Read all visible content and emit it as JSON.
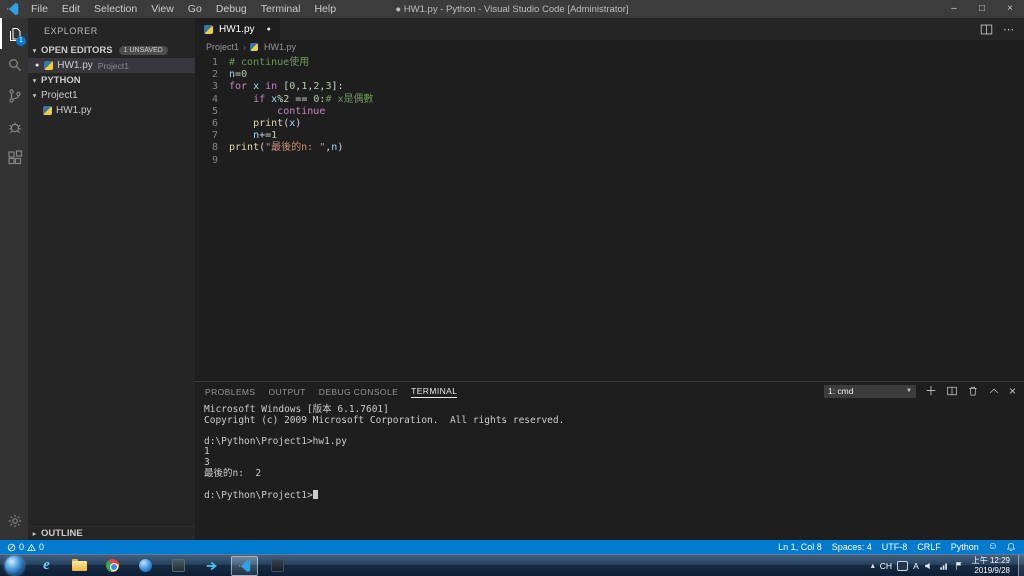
{
  "titlebar": {
    "menus": [
      "File",
      "Edit",
      "Selection",
      "View",
      "Go",
      "Debug",
      "Terminal",
      "Help"
    ],
    "title": "● HW1.py - Python - Visual Studio Code [Administrator]",
    "controls": {
      "minimize": "–",
      "maximize": "□",
      "close": "×"
    }
  },
  "activitybar": {
    "badge": "1",
    "items": [
      {
        "name": "explorer",
        "active": true
      },
      {
        "name": "search"
      },
      {
        "name": "source-control"
      },
      {
        "name": "debug"
      },
      {
        "name": "extensions"
      }
    ],
    "bottom": [
      {
        "name": "settings"
      }
    ]
  },
  "sidebar": {
    "title": "EXPLORER",
    "open_editors": {
      "label": "OPEN EDITORS",
      "badge": "1 UNSAVED",
      "item": {
        "dirty": "●",
        "file": "HW1.py",
        "detail": "Project1"
      }
    },
    "workspace": {
      "label": "PYTHON"
    },
    "tree": {
      "folder": "Project1",
      "file": "HW1.py"
    },
    "outline": {
      "label": "OUTLINE"
    }
  },
  "editor": {
    "tab_label": "HW1.py",
    "tab_dirty": "●",
    "breadcrumb": [
      "Project1",
      "HW1.py"
    ],
    "code_lines": [
      {
        "n": 1,
        "tokens": [
          {
            "c": "comment",
            "t": "# continue使用"
          }
        ]
      },
      {
        "n": 2,
        "tokens": [
          {
            "c": "var",
            "t": "n"
          },
          {
            "c": "op",
            "t": "="
          },
          {
            "c": "num",
            "t": "0"
          }
        ]
      },
      {
        "n": 3,
        "tokens": [
          {
            "c": "kw",
            "t": "for"
          },
          {
            "c": "plain",
            "t": " "
          },
          {
            "c": "var",
            "t": "x"
          },
          {
            "c": "plain",
            "t": " "
          },
          {
            "c": "kw",
            "t": "in"
          },
          {
            "c": "plain",
            "t": " ["
          },
          {
            "c": "num",
            "t": "0"
          },
          {
            "c": "plain",
            "t": ","
          },
          {
            "c": "num",
            "t": "1"
          },
          {
            "c": "plain",
            "t": ","
          },
          {
            "c": "num",
            "t": "2"
          },
          {
            "c": "plain",
            "t": ","
          },
          {
            "c": "num",
            "t": "3"
          },
          {
            "c": "plain",
            "t": "]:"
          }
        ]
      },
      {
        "n": 4,
        "tokens": [
          {
            "c": "plain",
            "t": "    "
          },
          {
            "c": "kw",
            "t": "if"
          },
          {
            "c": "plain",
            "t": " "
          },
          {
            "c": "var",
            "t": "x"
          },
          {
            "c": "op",
            "t": "%"
          },
          {
            "c": "num",
            "t": "2"
          },
          {
            "c": "plain",
            "t": " "
          },
          {
            "c": "op",
            "t": "=="
          },
          {
            "c": "plain",
            "t": " "
          },
          {
            "c": "num",
            "t": "0"
          },
          {
            "c": "plain",
            "t": ":"
          },
          {
            "c": "comment",
            "t": "# x是偶數"
          }
        ]
      },
      {
        "n": 5,
        "tokens": [
          {
            "c": "plain",
            "t": "        "
          },
          {
            "c": "kw",
            "t": "continue"
          }
        ]
      },
      {
        "n": 6,
        "tokens": [
          {
            "c": "plain",
            "t": "    "
          },
          {
            "c": "fn",
            "t": "print"
          },
          {
            "c": "plain",
            "t": "("
          },
          {
            "c": "var",
            "t": "x"
          },
          {
            "c": "plain",
            "t": ")"
          }
        ]
      },
      {
        "n": 7,
        "tokens": [
          {
            "c": "plain",
            "t": "    "
          },
          {
            "c": "var",
            "t": "n"
          },
          {
            "c": "op",
            "t": "+="
          },
          {
            "c": "num",
            "t": "1"
          }
        ]
      },
      {
        "n": 8,
        "tokens": [
          {
            "c": "fn",
            "t": "print"
          },
          {
            "c": "plain",
            "t": "("
          },
          {
            "c": "str",
            "t": "\"最後的n: \""
          },
          {
            "c": "plain",
            "t": ","
          },
          {
            "c": "var",
            "t": "n"
          },
          {
            "c": "plain",
            "t": ")"
          }
        ]
      },
      {
        "n": 9,
        "tokens": []
      }
    ]
  },
  "panel": {
    "tabs": [
      {
        "name": "problems",
        "label": "PROBLEMS"
      },
      {
        "name": "output",
        "label": "OUTPUT"
      },
      {
        "name": "debug-console",
        "label": "DEBUG CONSOLE"
      },
      {
        "name": "terminal",
        "label": "TERMINAL",
        "active": true
      }
    ],
    "dropdown_value": "1: cmd",
    "terminal_lines": [
      "Microsoft Windows [版本 6.1.7601]",
      "Copyright (c) 2009 Microsoft Corporation.  All rights reserved.",
      "",
      "d:\\Python\\Project1>hw1.py",
      "1",
      "3",
      "最後的n:  2",
      "",
      "d:\\Python\\Project1>"
    ],
    "cursor_line": 8
  },
  "statusbar": {
    "problems": {
      "errors": "0",
      "warnings": "0"
    },
    "right": [
      {
        "name": "cursor-position",
        "label": "Ln 1, Col 8"
      },
      {
        "name": "indentation",
        "label": "Spaces: 4"
      },
      {
        "name": "encoding",
        "label": "UTF-8"
      },
      {
        "name": "eol",
        "label": "CRLF"
      },
      {
        "name": "language-mode",
        "label": "Python"
      }
    ]
  },
  "taskbar": {
    "icons": [
      {
        "name": "ie-icon",
        "kind": "ie"
      },
      {
        "name": "file-explorer-icon",
        "kind": "folder"
      },
      {
        "name": "chrome-icon",
        "kind": "chrome"
      },
      {
        "name": "media-app-icon",
        "kind": "bluecircle"
      },
      {
        "name": "app-icon-1",
        "kind": "darkapp"
      },
      {
        "name": "arrow-app-icon",
        "kind": "arrow"
      },
      {
        "name": "vscode-icon",
        "kind": "vscode",
        "active": true
      },
      {
        "name": "app-icon-2",
        "kind": "darkapp2"
      }
    ],
    "tray": {
      "ime_lang": "CH",
      "ime_mode": "A",
      "time": "上午 12:29",
      "date": "2019/9/28"
    }
  }
}
